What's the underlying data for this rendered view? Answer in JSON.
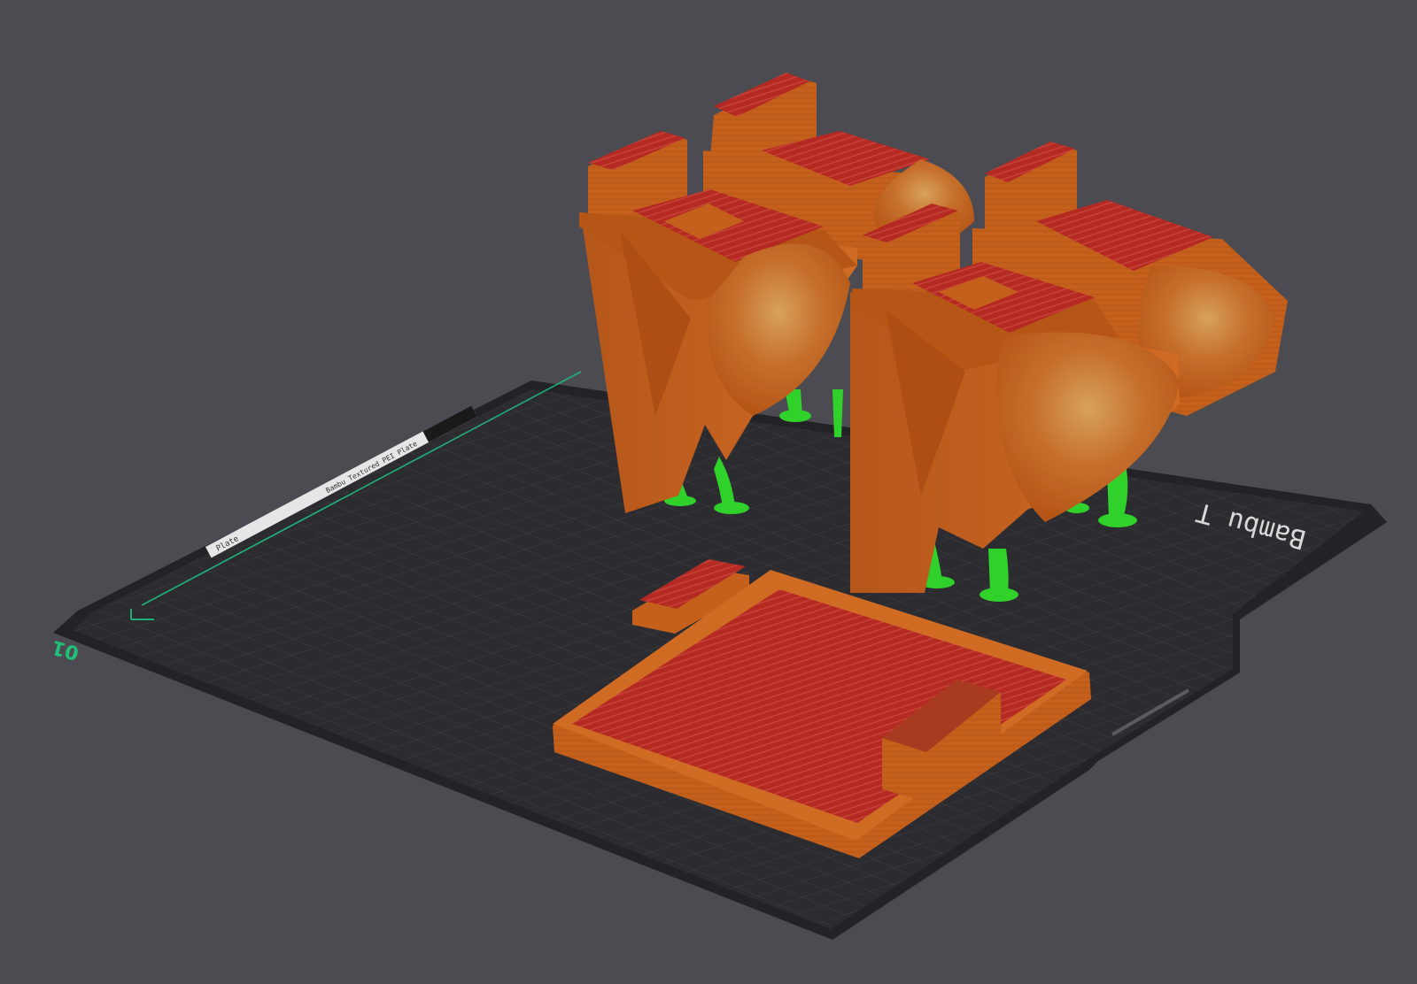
{
  "colors": {
    "background": "#4b4b51",
    "bed_surface": "#2c2c30",
    "bed_grid": "#3e3e44",
    "model_orange": "#c4601c",
    "model_top_red": "#b42a22",
    "support_green": "#2fd12a",
    "axis_green": "#1fb07a"
  },
  "bed": {
    "brand_text": "Bambu T",
    "origin_label": "01",
    "plate_strip_text": "Bambu Textured PEI Plate",
    "plate_strip_sub": "Plate"
  },
  "objects": [
    {
      "name": "holder-back-left",
      "kind": "holder"
    },
    {
      "name": "holder-back-right",
      "kind": "holder"
    },
    {
      "name": "holder-front-left",
      "kind": "holder"
    },
    {
      "name": "holder-front-right",
      "kind": "holder"
    },
    {
      "name": "tray",
      "kind": "tray"
    },
    {
      "name": "small-lid",
      "kind": "block"
    }
  ]
}
